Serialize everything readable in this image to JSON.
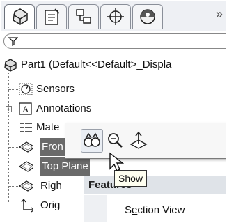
{
  "tabs": {
    "items": [
      {
        "name": "featuremanager-tab",
        "icon": "feature-tree-icon"
      },
      {
        "name": "propertymanager-tab",
        "icon": "property-manager-icon"
      },
      {
        "name": "configurationmanager-tab",
        "icon": "configuration-icon"
      },
      {
        "name": "dimxpert-tab",
        "icon": "dimxpert-icon"
      },
      {
        "name": "display-manager-tab",
        "icon": "display-manager-icon"
      }
    ],
    "more_label": "»"
  },
  "filter": {
    "icon": "filter-icon"
  },
  "tree": {
    "root": "Part1  (Default<<Default>_Displa",
    "items": [
      {
        "label": "Sensors",
        "icon": "sensors-icon"
      },
      {
        "label": "Annotations",
        "icon": "annotations-icon"
      },
      {
        "label": "Mate",
        "icon": "material-icon"
      },
      {
        "label": "Fron",
        "icon": "plane-icon"
      },
      {
        "label": "Top Plane",
        "icon": "plane-icon"
      },
      {
        "label": "Righ",
        "icon": "plane-icon"
      },
      {
        "label": "Orig",
        "icon": "origin-icon"
      }
    ]
  },
  "popup": {
    "buttons": [
      "show-icon",
      "zoom-to-selection-icon",
      "normal-to-icon"
    ]
  },
  "tooltip": {
    "text": "Show"
  },
  "menu": {
    "header": "Features",
    "items": [
      {
        "label": "Section View"
      }
    ]
  }
}
